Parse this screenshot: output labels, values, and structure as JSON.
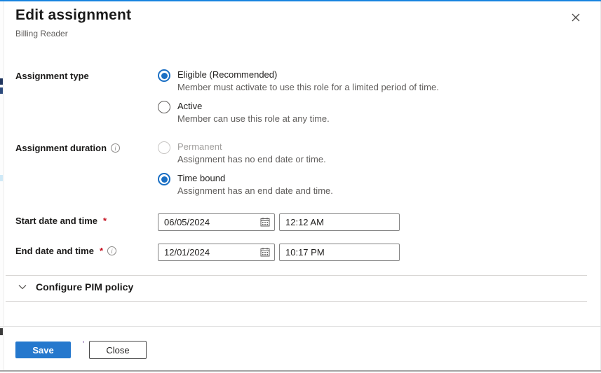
{
  "colors": {
    "top_line_blue": "#1884e0",
    "accent_radio_blue": "#1a6fc4",
    "save_button_blue": "#2578cd",
    "required_red": "#c50f1f",
    "text_primary": "#201f1e",
    "text_secondary": "#605e5c",
    "disabled_text": "#a19f9d",
    "divider_gray": "#d6d4d2",
    "bottom_line_gray": "#a3a3a3"
  },
  "header": {
    "title": "Edit assignment",
    "subtitle": "Billing Reader",
    "close_icon": "x-icon"
  },
  "form": {
    "assignment_type": {
      "label": "Assignment type",
      "options": [
        {
          "label": "Eligible (Recommended)",
          "description": "Member must activate to use this role for a limited period of time.",
          "selected": true,
          "disabled": false
        },
        {
          "label": "Active",
          "description": "Member can use this role at any time.",
          "selected": false,
          "disabled": false
        }
      ]
    },
    "assignment_duration": {
      "label": "Assignment duration",
      "has_info_icon": true,
      "options": [
        {
          "label": "Permanent",
          "description": "Assignment has no end date or time.",
          "selected": false,
          "disabled": true
        },
        {
          "label": "Time bound",
          "description": "Assignment has an end date and time.",
          "selected": true,
          "disabled": false
        }
      ]
    },
    "start": {
      "label": "Start date and time",
      "required_marker": "*",
      "date_value": "06/05/2024",
      "time_value": "12:12 AM"
    },
    "end": {
      "label": "End date and time",
      "required_marker": "*",
      "has_info_icon": true,
      "date_value": "12/01/2024",
      "time_value": "10:17 PM"
    }
  },
  "pim_section": {
    "label": "Configure PIM policy",
    "expanded": false
  },
  "footer": {
    "save_label": "Save",
    "close_label": "Close",
    "stray_mark": "'"
  }
}
